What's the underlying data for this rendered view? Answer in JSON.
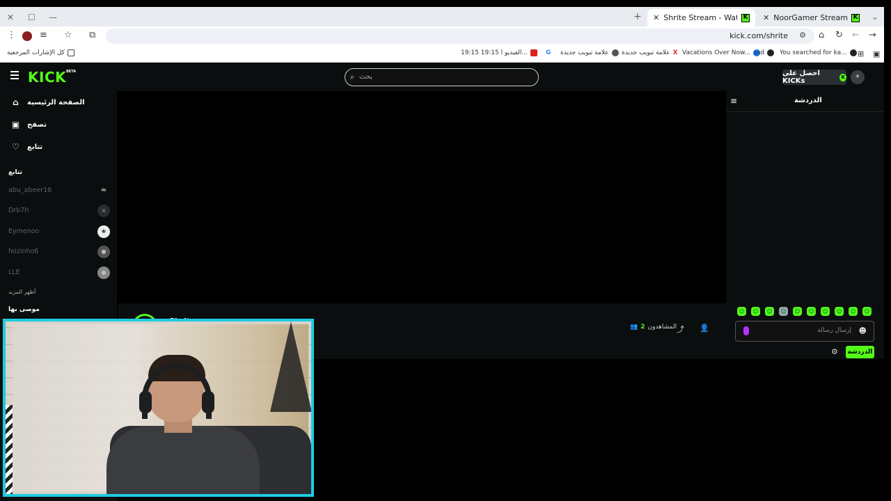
{
  "browser": {
    "tabs": [
      {
        "title": "Shrite Stream - Watch Live on K",
        "active": true
      },
      {
        "title": "NoorGamer Stream - Watch Li",
        "active": false
      }
    ],
    "url": "kick.com/shrite",
    "bookmarks": [
      {
        "label": "كل الإشارات المرجعية",
        "icon": "folder-icon"
      },
      {
        "label": "19:15 19:15 الفيديو ا...",
        "icon": "youtube-icon"
      },
      {
        "label": "",
        "icon": "youtube-icon"
      },
      {
        "label": "",
        "icon": "google-icon"
      },
      {
        "label": "علامة تبويب جديدة",
        "icon": "chrome-icon"
      },
      {
        "label": "علامة تبويب جديدة",
        "icon": "x-icon"
      },
      {
        "label": "Vacations Over Now...",
        "icon": "facebook-icon"
      },
      {
        "label": "ssd",
        "icon": "github-icon"
      },
      {
        "label": "You searched for ka...",
        "icon": "site-icon"
      }
    ]
  },
  "kick": {
    "logo": "KICK",
    "beta": "BETA",
    "search_placeholder": "بحث",
    "get_kicks": "احصل على KICKs",
    "nav": [
      {
        "label": "الصفحة الرئيسية",
        "icon": "home-icon"
      },
      {
        "label": "تصفح",
        "icon": "browse-icon"
      },
      {
        "label": "تتابع",
        "icon": "heart-icon"
      }
    ],
    "following_header": "تتابع",
    "following": [
      {
        "name": "abu_abeer16"
      },
      {
        "name": "Drb7h"
      },
      {
        "name": "Eymenoo"
      },
      {
        "name": "feizinho6"
      },
      {
        "name": "LLE"
      }
    ],
    "show_more": "أظهر المزيد",
    "recommended_header": "موصى بها",
    "viewers_label": "المشاهدون",
    "viewers_count": "2",
    "channel_name": "Shrite",
    "chat": {
      "title": "الدردشة",
      "placeholder": "إرسال رسالة",
      "send": "الدردشة"
    }
  }
}
